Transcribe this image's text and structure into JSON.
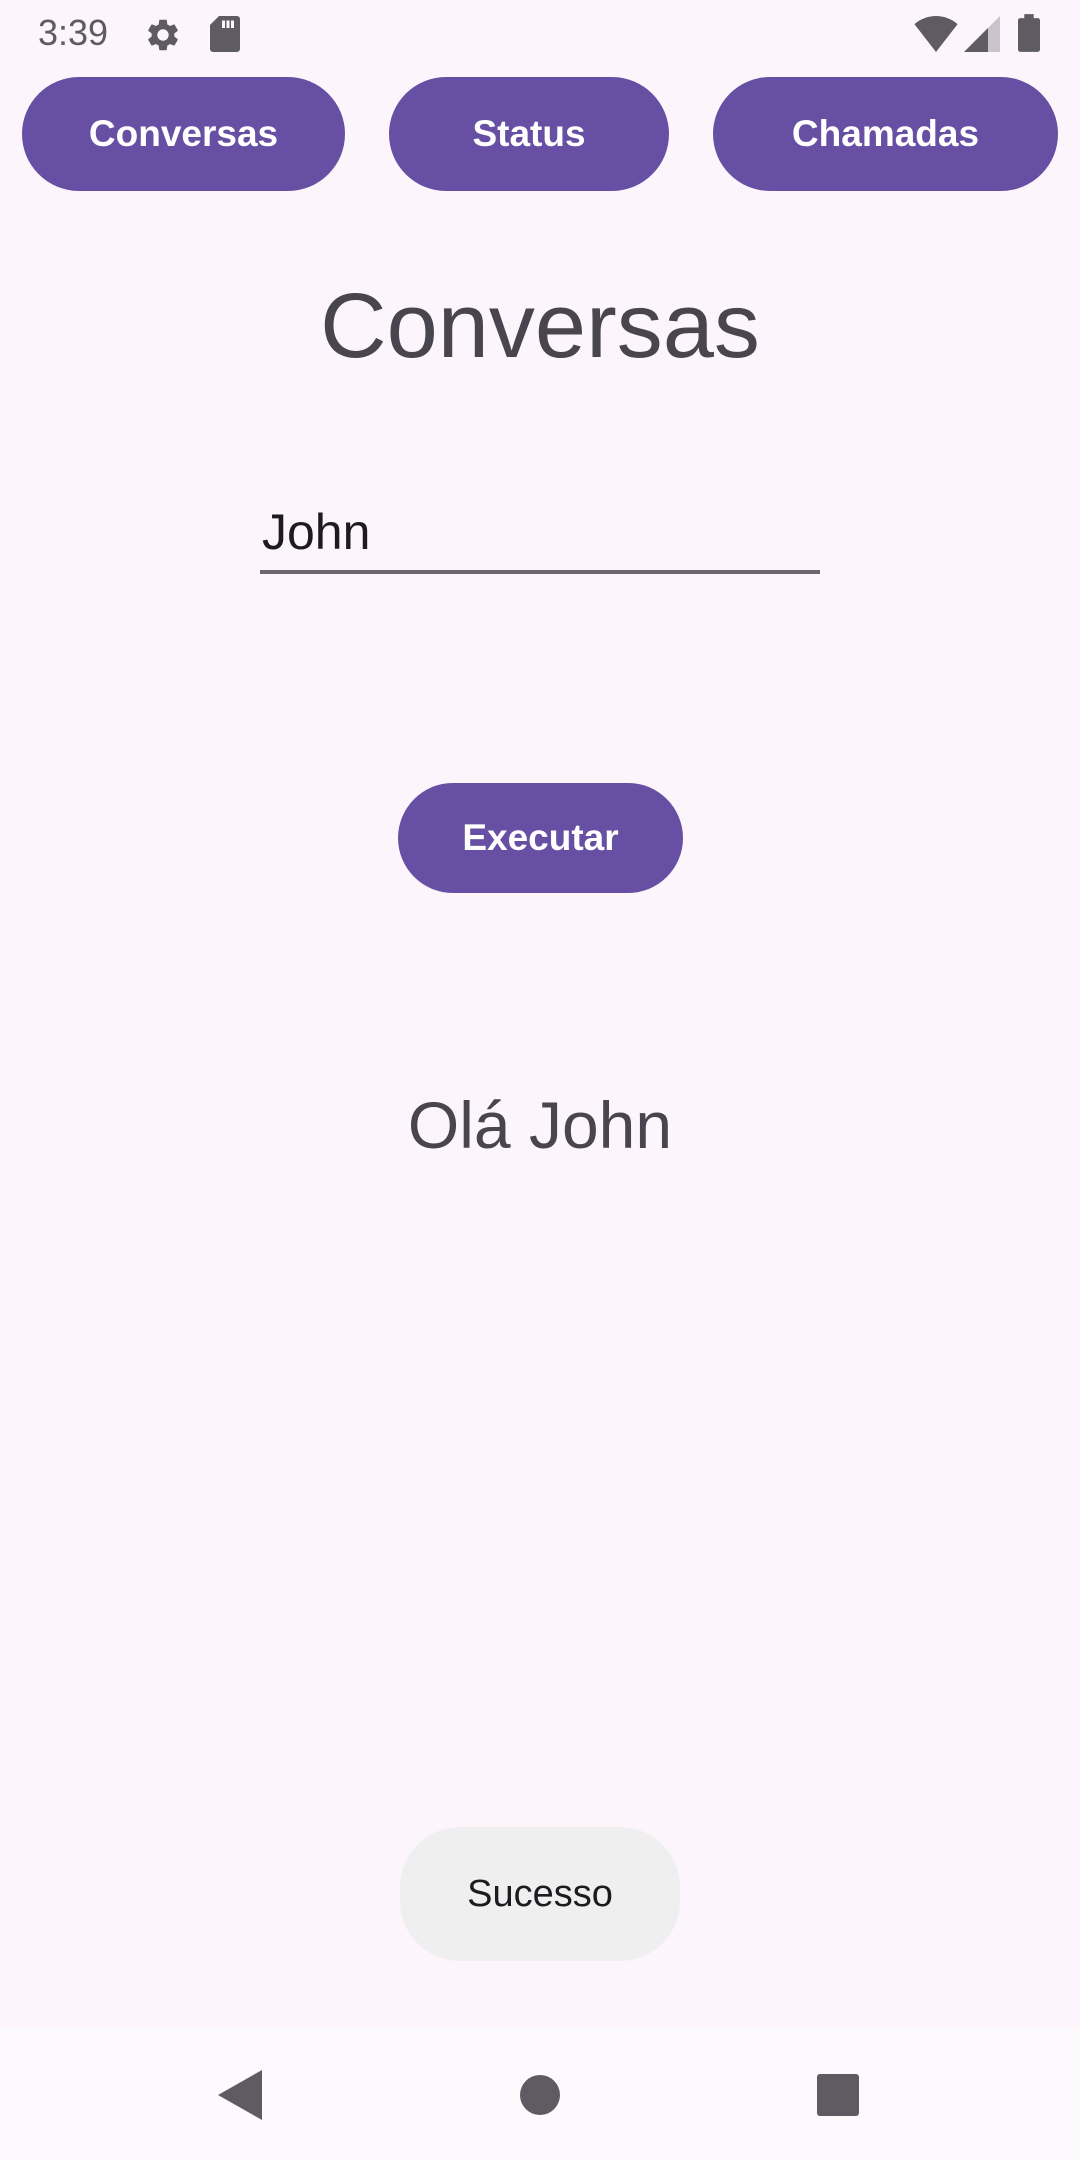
{
  "status_bar": {
    "time": "3:39",
    "icons": [
      "gear-icon",
      "sd-card-icon",
      "wifi-icon",
      "signal-icon",
      "battery-icon"
    ]
  },
  "top_buttons": {
    "conversas": "Conversas",
    "status": "Status",
    "chamadas": "Chamadas"
  },
  "main": {
    "title": "Conversas",
    "name_input_value": "John",
    "execute_label": "Executar",
    "result_text": "Olá John"
  },
  "toast": {
    "message": "Sucesso"
  },
  "nav_bar": {
    "icons": [
      "back-icon",
      "home-icon",
      "recents-icon"
    ]
  },
  "colors": {
    "accent": "#6750a4",
    "background": "#fcf5fc",
    "text": "#49454f",
    "toast_bg": "#efefef"
  }
}
